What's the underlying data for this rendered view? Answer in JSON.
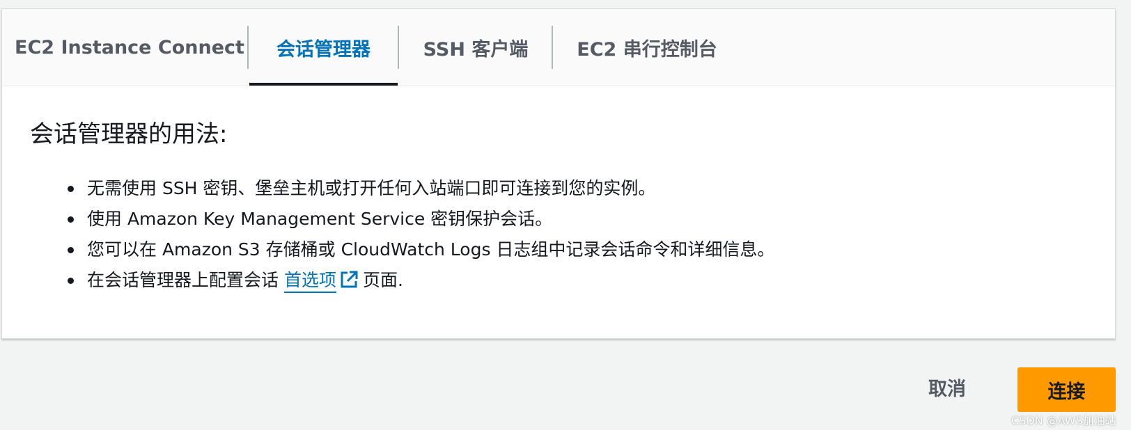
{
  "tabs": [
    {
      "label": "EC2 Instance Connect",
      "active": false
    },
    {
      "label": "会话管理器",
      "active": true
    },
    {
      "label": "SSH 客户端",
      "active": false
    },
    {
      "label": "EC2 串行控制台",
      "active": false
    }
  ],
  "content": {
    "title": "会话管理器的用法:",
    "bullets": [
      "无需使用 SSH 密钥、堡垒主机或打开任何入站端口即可连接到您的实例。",
      "使用 Amazon Key Management Service 密钥保护会话。",
      "您可以在 Amazon S3 存储桶或 CloudWatch Logs 日志组中记录会话命令和详细信息。"
    ],
    "last_bullet": {
      "prefix": "在会话管理器上配置会话",
      "link_text": "首选项",
      "suffix": "页面."
    }
  },
  "footer": {
    "cancel_label": "取消",
    "connect_label": "连接"
  },
  "watermark": "CSDN @AWS加油站",
  "colors": {
    "accent": "#0073bb",
    "primary_button": "#ff9900",
    "active_tab_underline": "#16191f"
  },
  "icons": {
    "external_link": "external-link-icon"
  }
}
